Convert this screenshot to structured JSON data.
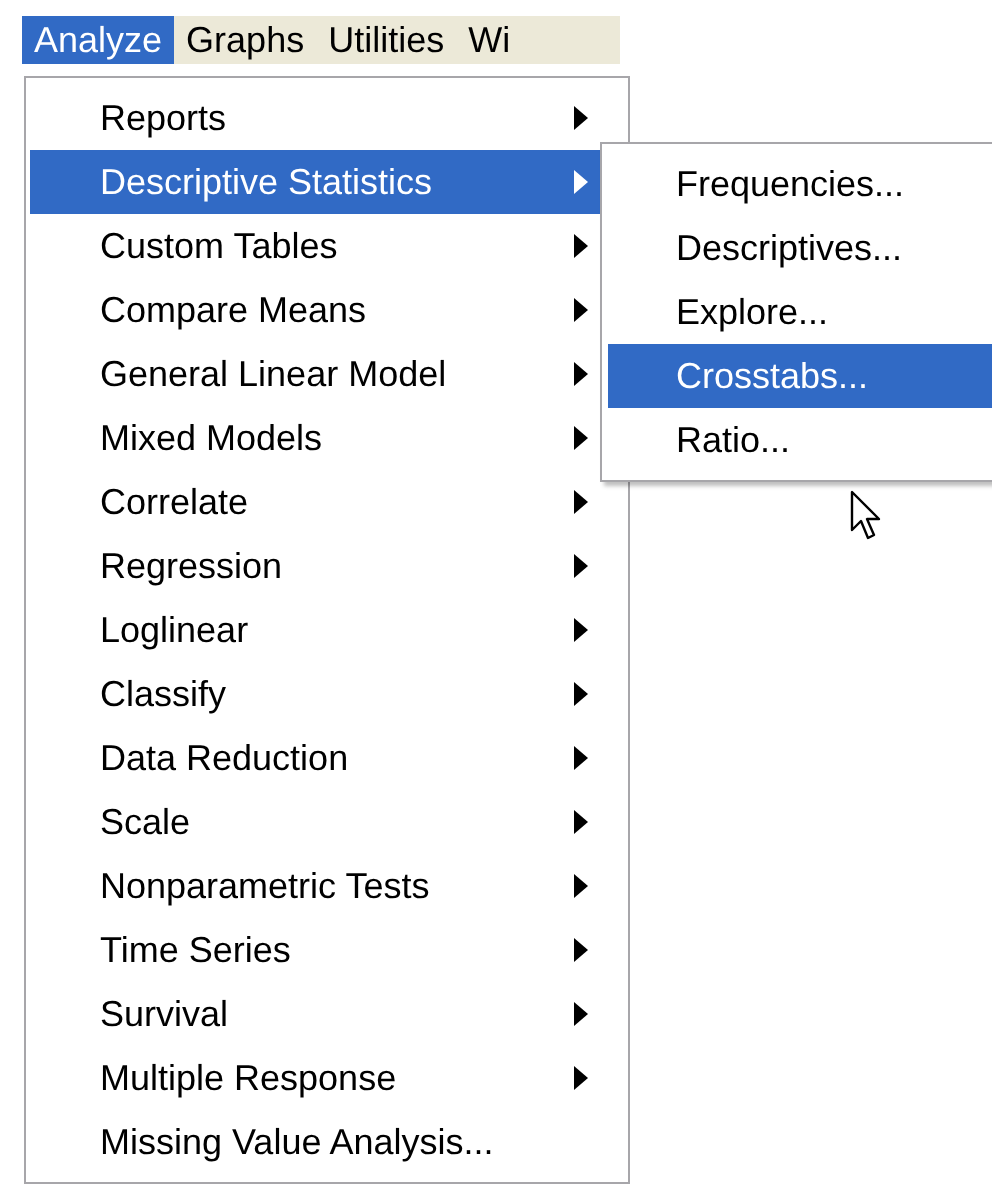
{
  "menubar": [
    {
      "label": "Analyze",
      "selected": true
    },
    {
      "label": "Graphs",
      "selected": false
    },
    {
      "label": "Utilities",
      "selected": false
    },
    {
      "label": "Wi",
      "selected": false
    }
  ],
  "menu": [
    {
      "label": "Reports",
      "submenu": true,
      "selected": false
    },
    {
      "label": "Descriptive Statistics",
      "submenu": true,
      "selected": true
    },
    {
      "label": "Custom Tables",
      "submenu": true,
      "selected": false
    },
    {
      "label": "Compare Means",
      "submenu": true,
      "selected": false
    },
    {
      "label": "General Linear Model",
      "submenu": true,
      "selected": false
    },
    {
      "label": "Mixed Models",
      "submenu": true,
      "selected": false
    },
    {
      "label": "Correlate",
      "submenu": true,
      "selected": false
    },
    {
      "label": "Regression",
      "submenu": true,
      "selected": false
    },
    {
      "label": "Loglinear",
      "submenu": true,
      "selected": false
    },
    {
      "label": "Classify",
      "submenu": true,
      "selected": false
    },
    {
      "label": "Data Reduction",
      "submenu": true,
      "selected": false
    },
    {
      "label": "Scale",
      "submenu": true,
      "selected": false
    },
    {
      "label": "Nonparametric Tests",
      "submenu": true,
      "selected": false
    },
    {
      "label": "Time Series",
      "submenu": true,
      "selected": false
    },
    {
      "label": "Survival",
      "submenu": true,
      "selected": false
    },
    {
      "label": "Multiple Response",
      "submenu": true,
      "selected": false
    },
    {
      "label": "Missing Value Analysis...",
      "submenu": false,
      "selected": false
    }
  ],
  "submenu": [
    {
      "label": "Frequencies...",
      "selected": false
    },
    {
      "label": "Descriptives...",
      "selected": false
    },
    {
      "label": "Explore...",
      "selected": false
    },
    {
      "label": "Crosstabs...",
      "selected": true
    },
    {
      "label": "Ratio...",
      "selected": false
    }
  ]
}
